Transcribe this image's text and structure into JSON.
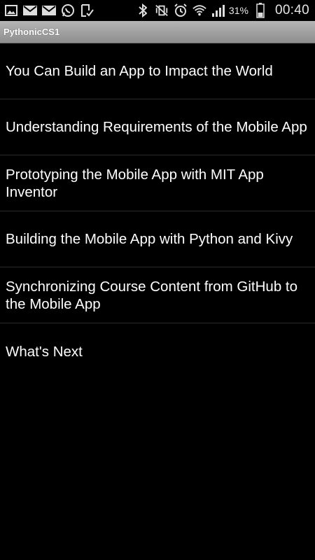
{
  "status_bar": {
    "battery_percent": "31%",
    "time": "00:40",
    "left_icons": [
      "gallery-icon",
      "gmail-icon",
      "gmail-icon",
      "whatsapp-icon",
      "task-check-icon"
    ],
    "right_icons": [
      "bluetooth-icon",
      "vibrate-mute-icon",
      "alarm-icon",
      "wifi-icon",
      "signal-icon",
      "battery-icon"
    ]
  },
  "app": {
    "title": "PythonicCS1"
  },
  "menu": {
    "items": [
      {
        "label": "You Can Build an App to Impact the World"
      },
      {
        "label": "Understanding Requirements of the Mobile App"
      },
      {
        "label": "Prototyping the Mobile App with MIT App Inventor"
      },
      {
        "label": "Building the Mobile App with Python and Kivy"
      },
      {
        "label": "Synchronizing Course Content from GitHub to the Mobile App"
      },
      {
        "label": "What's Next"
      }
    ]
  },
  "colors": {
    "background": "#000000",
    "title_bar": "#a0a0a0",
    "text": "#ffffff",
    "divider": "#2a2a2a"
  }
}
